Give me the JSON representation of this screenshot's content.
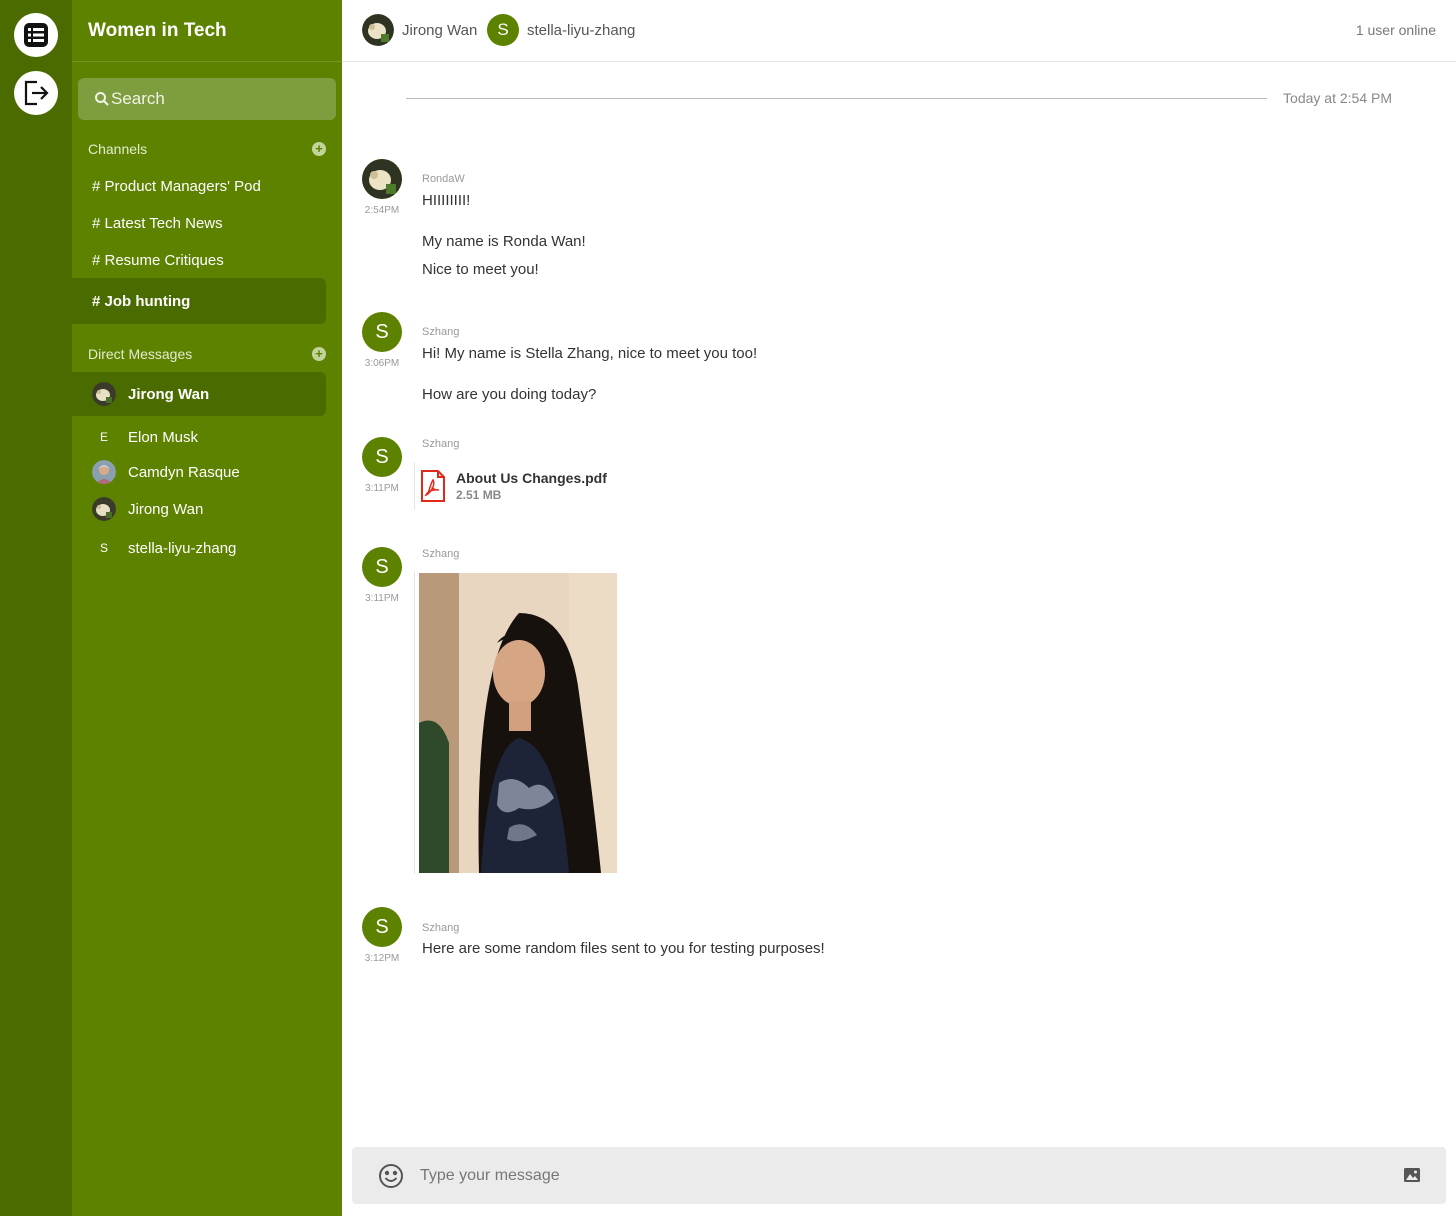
{
  "workspace": {
    "title": "Women in Tech"
  },
  "search": {
    "placeholder": "Search"
  },
  "channels": {
    "heading": "Channels",
    "items": [
      {
        "label": "# Product Managers' Pod"
      },
      {
        "label": "# Latest Tech News"
      },
      {
        "label": "# Resume Critiques"
      },
      {
        "label": "# Job hunting",
        "active": true
      }
    ]
  },
  "direct_messages": {
    "heading": "Direct Messages",
    "items": [
      {
        "label": "Jirong Wan",
        "active": true,
        "avatar": "photo-dog"
      },
      {
        "label": "Elon Musk",
        "initial": "E"
      },
      {
        "label": "Camdyn Rasque",
        "avatar": "photo-person"
      },
      {
        "label": "Jirong Wan",
        "avatar": "photo-dog"
      },
      {
        "label": "stella-liyu-zhang",
        "initial": "S"
      }
    ]
  },
  "topbar": {
    "users": [
      {
        "name": "Jirong Wan",
        "avatar": "photo-dog"
      },
      {
        "name": "stella-liyu-zhang",
        "initial": "S"
      }
    ],
    "online": "1 user online"
  },
  "date_separator": "Today at 2:54 PM",
  "messages": [
    {
      "sender": "RondaW",
      "time": "2:54PM",
      "avatar": "photo-dog",
      "lines": [
        "HIIIIIIII!",
        "My name is Ronda Wan!",
        "Nice to meet you!"
      ]
    },
    {
      "sender": "Szhang",
      "time": "3:06PM",
      "initial": "S",
      "lines": [
        "Hi! My name is Stella Zhang, nice to meet you too!",
        "How are you doing today?"
      ]
    },
    {
      "sender": "Szhang",
      "time": "3:11PM",
      "initial": "S",
      "file": {
        "name": "About Us Changes.pdf",
        "size": "2.51 MB",
        "icon": "pdf-icon"
      }
    },
    {
      "sender": "Szhang",
      "time": "3:11PM",
      "initial": "S",
      "image": "portrait-photo"
    },
    {
      "sender": "Szhang",
      "time": "3:12PM",
      "initial": "S",
      "lines": [
        "Here are some random files sent to you for testing purposes!"
      ]
    }
  ],
  "composer": {
    "placeholder": "Type your message"
  },
  "colors": {
    "rail": "#4b6b00",
    "sidebar": "#5c8200",
    "active_item": "#4a6b00",
    "accent": "#5c8200",
    "pdf": "#e1281d"
  }
}
